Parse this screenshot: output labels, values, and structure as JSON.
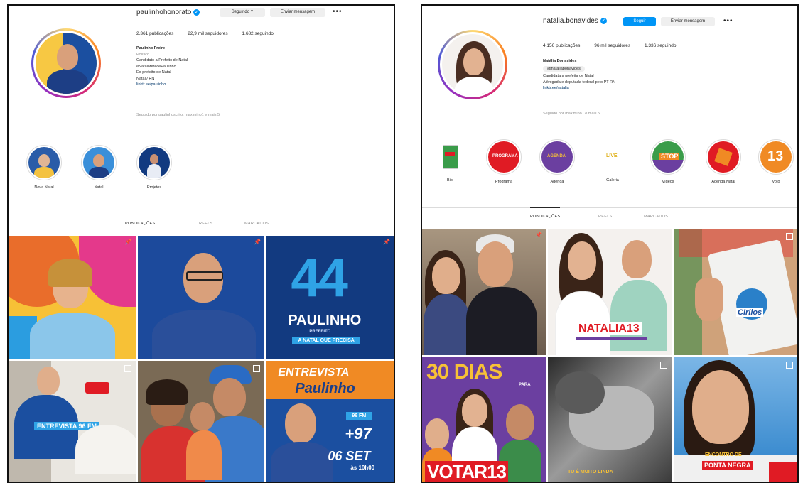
{
  "left": {
    "username": "paulinhohonorato",
    "buttons": {
      "following": "Seguindo ˅",
      "message": "Enviar mensagem",
      "more": "•••"
    },
    "stats": {
      "posts": "2.361 publicações",
      "followers": "22,9 mil seguidores",
      "following": "1.682 seguindo"
    },
    "bio": [
      "Paulinho Freire",
      "Político",
      "Candidato a Prefeito de Natal",
      "#NatalMerecePaulinho",
      "Ex-prefeito de Natal",
      "Natal / RN",
      "linktr.ee/paulinho"
    ],
    "followed_by": "Seguido por paulinhoscrito, maximino1 e mais 5",
    "highlights": [
      {
        "label": "Nova Natal"
      },
      {
        "label": "Natal"
      },
      {
        "label": "Projetos"
      }
    ],
    "tabs": [
      "PUBLICAÇÕES",
      "REELS",
      "MARCADOS"
    ],
    "posts": {
      "p3_number": "44",
      "p3_name": "PAULINHO",
      "p3_sub": "PREFEITO",
      "p3_bar": "A NATAL QUE PRECISA",
      "p4_caption": "ENTREVISTA 96 FM",
      "p6_title1": "ENTREVISTA",
      "p6_title2": "Paulinho",
      "p6_station": "96 FM",
      "p6_freq": "+97",
      "p6_date": "06 SET",
      "p6_time": "às 10h00"
    }
  },
  "right": {
    "username": "natalia.bonavides",
    "buttons": {
      "follow": "Seguir",
      "message": "Enviar mensagem",
      "more": "•••"
    },
    "stats": {
      "posts": "4.156 publicações",
      "followers": "96 mil seguidores",
      "following": "1.336 seguindo"
    },
    "bio": [
      "Natália Bonavides",
      "@nataliabonavides",
      "Candidata a prefeita de Natal",
      "Advogada e deputada federal pelo PT-RN",
      "linktr.ee/natalia"
    ],
    "followed_by": "Seguido por maximino1 e mais 5",
    "highlights": [
      {
        "label": "Bio"
      },
      {
        "label": "Programa"
      },
      {
        "label": "Agenda"
      },
      {
        "label": "Galeria"
      },
      {
        "label": "Vídeos"
      },
      {
        "label": "Agenda Natal"
      },
      {
        "label": "Voto"
      }
    ],
    "highlight_texts": {
      "h2": "PROGRAMA",
      "h3": "AGENDA",
      "h4": "LIVE",
      "h5": "STOP",
      "h7": "13"
    },
    "tabs": [
      "PUBLICAÇÕES",
      "REELS",
      "MARCADOS"
    ],
    "posts": {
      "q2_name": "NATALIA13",
      "q3_brand": "Cirilos",
      "q4_days": "30 DIAS",
      "q4_para": "PARA",
      "q4_votar": "VOTAR13",
      "q5_caption": "TU É MUITO LINDA",
      "q6_line1": "ENCONTRO DE",
      "q6_line2": "PONTA NEGRA"
    }
  },
  "colors": {
    "ig_blue": "#0095f6",
    "left_blue": "#1b4fa0",
    "right_red": "#e01b24",
    "right_orange": "#f08a24",
    "right_purple": "#6b3fa0"
  }
}
